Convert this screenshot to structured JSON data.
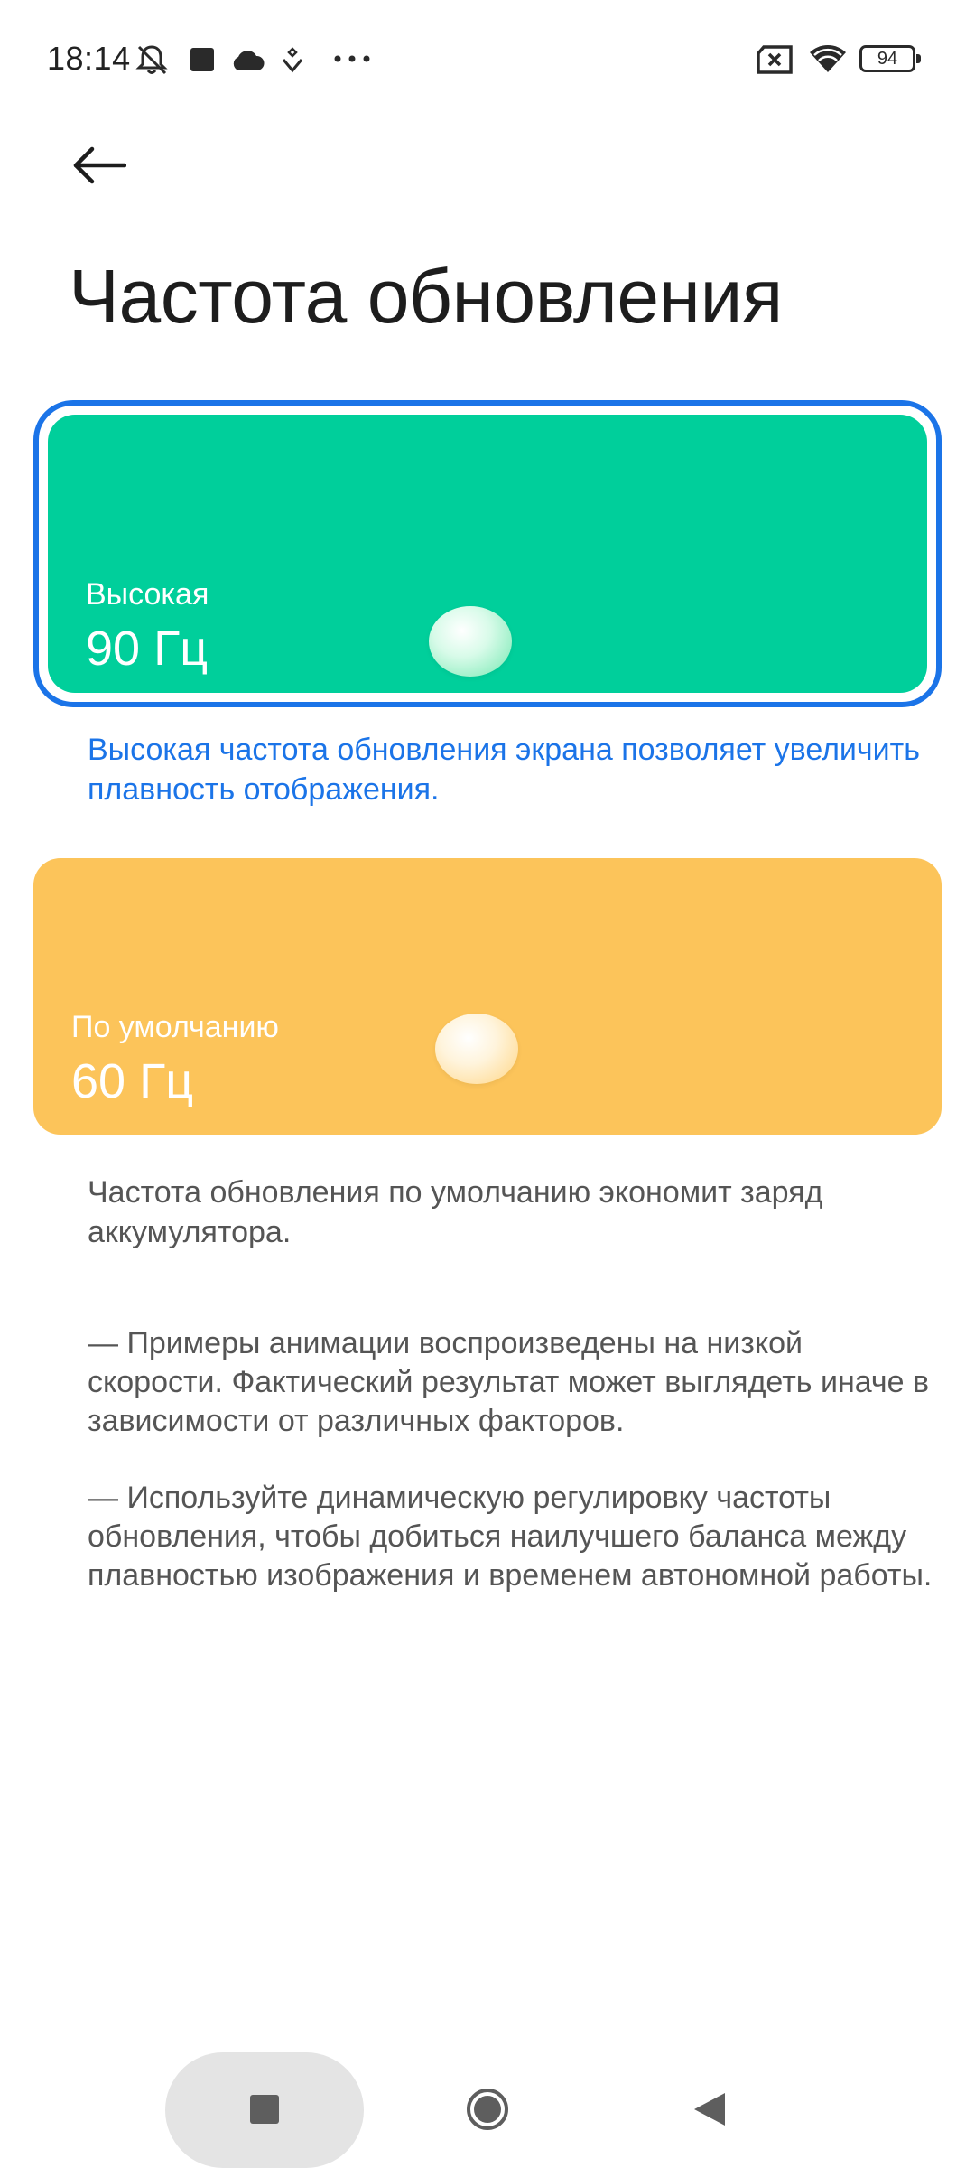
{
  "status_bar": {
    "time": "18:14",
    "battery": "94",
    "icons": [
      "bell-off-icon",
      "square-notification-icon",
      "cloud-icon",
      "location-heart-icon",
      "more-dots-icon",
      "sim-no-signal-icon",
      "wifi-icon",
      "battery-icon"
    ]
  },
  "header": {
    "back_icon": "arrow-left-icon",
    "title": "Частота обновления"
  },
  "options": [
    {
      "name": "Высокая",
      "rate": "90 Гц",
      "selected": true,
      "color": "#00cf9b",
      "description": "Высокая частота обновления экрана позволяет увеличить плавность отображения."
    },
    {
      "name": "По умолчанию",
      "rate": "60 Гц",
      "selected": false,
      "color": "#fcc45a",
      "description": "Частота обновления по умолчанию экономит заряд аккумулятора."
    }
  ],
  "notes": [
    "— Примеры анимации воспроизведены на низкой скорости. Фактический результат может выглядеть иначе в зависимости от различных факторов.",
    "— Используйте динамическую регулировку частоты обновления, чтобы добиться наилучшего баланса между плавностью изображения и временем автономной работы."
  ],
  "nav_bar": {
    "icons": [
      "recents-square-icon",
      "home-circle-icon",
      "back-triangle-icon"
    ]
  },
  "colors": {
    "accent": "#1b74e8",
    "high": "#00cf9b",
    "default": "#fcc45a"
  }
}
